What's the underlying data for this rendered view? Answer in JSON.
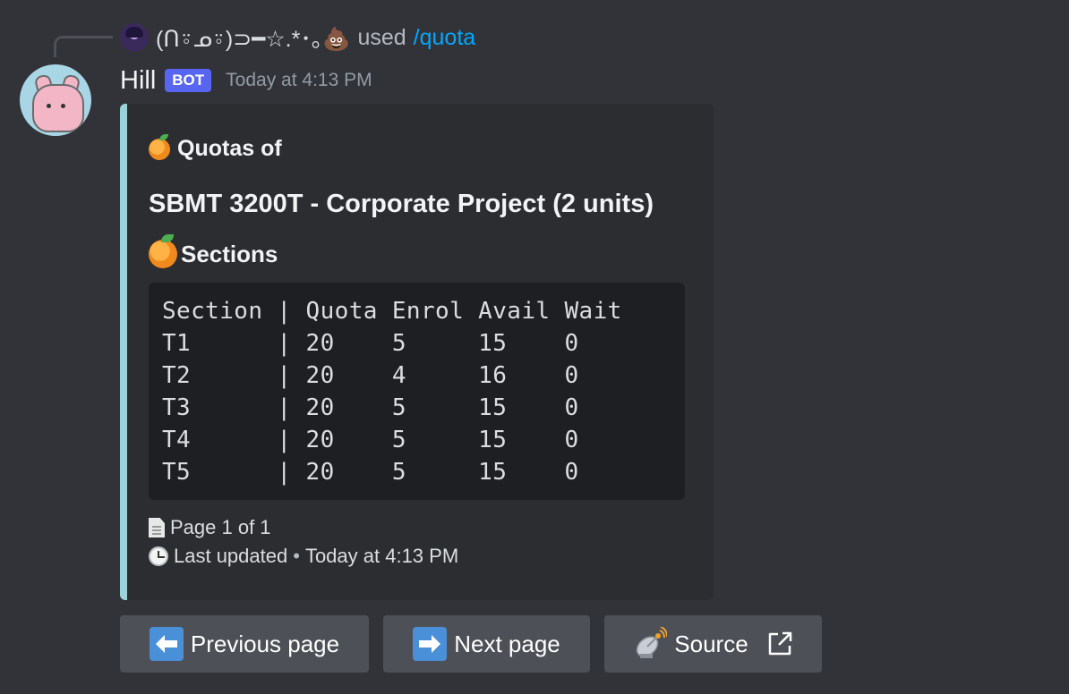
{
  "interaction": {
    "user_display": "(ᑎ⍤ᓄ⍤)⊃━☆.*･｡💩",
    "used_text": "used",
    "command": "/quota"
  },
  "message": {
    "author": "Hill",
    "bot_tag": "BOT",
    "timestamp": "Today at 4:13 PM"
  },
  "embed": {
    "accent_color": "#9ad3d8",
    "author": "Quotas of",
    "title": "SBMT 3200T - Corporate Project (2 units)",
    "field_name": "Sections",
    "table_lines": [
      "Section | Quota Enrol Avail Wait",
      "T1      | 20    5     15    0",
      "T2      | 20    4     16    0",
      "T3      | 20    5     15    0",
      "T4      | 20    5     15    0",
      "T5      | 20    5     15    0"
    ],
    "footer_page": "Page 1 of 1",
    "footer_updated_label": "Last updated",
    "footer_separator": "•",
    "footer_updated_time": "Today at 4:13 PM"
  },
  "buttons": {
    "previous": {
      "label": "Previous page",
      "icon": "left-arrow-icon"
    },
    "next": {
      "label": "Next page",
      "icon": "right-arrow-icon"
    },
    "source": {
      "label": "Source",
      "icon": "satellite-dish-icon",
      "trailing_icon": "external-link-icon"
    }
  }
}
